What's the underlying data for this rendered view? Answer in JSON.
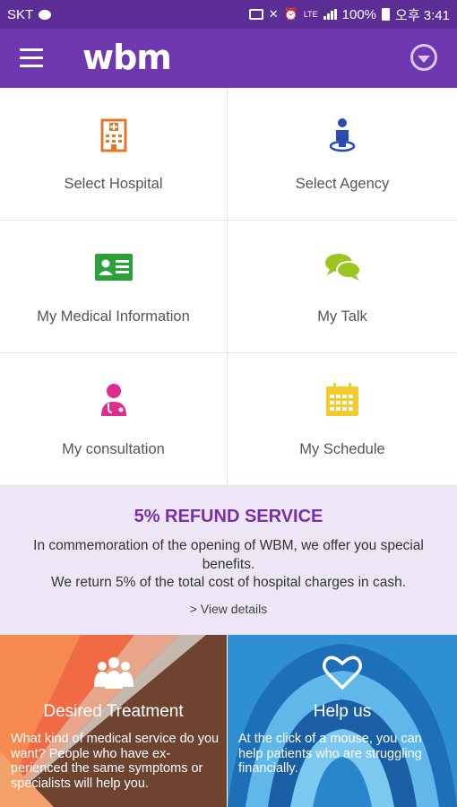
{
  "status_bar": {
    "carrier": "SKT",
    "battery": "100%",
    "time": "오후 3:41",
    "network": "LTE"
  },
  "app_bar": {
    "logo": "wbm",
    "icons": {
      "menu": "hamburger-menu-icon",
      "dropdown": "chevron-circle-down-icon"
    }
  },
  "menu_grid": [
    {
      "label": "Select Hospital",
      "icon": "hospital-building-icon",
      "color": "#e0782c"
    },
    {
      "label": "Select Agency",
      "icon": "person-location-icon",
      "color": "#2b4bb4"
    },
    {
      "label": "My Medical Information",
      "icon": "id-card-icon",
      "color": "#2ca03a"
    },
    {
      "label": "My Talk",
      "icon": "chat-bubbles-icon",
      "color": "#9bc51f"
    },
    {
      "label": "My consultation",
      "icon": "doctor-icon",
      "color": "#e02a8c"
    },
    {
      "label": "My Schedule",
      "icon": "calendar-icon",
      "color": "#f1cc2a"
    }
  ],
  "promo": {
    "title": "5% REFUND SERVICE",
    "line1": "In commemoration of the opening of WBM, we offer you special benefits.",
    "line2": "We return 5% of the total cost of hospital charges in cash.",
    "link": "> View details"
  },
  "panels": [
    {
      "title": "Desired Treatment",
      "text": "What kind of medical service do you want? People who have ex-perienced the same symptoms or specialists will help you.",
      "icon": "people-group-icon"
    },
    {
      "title": "Help us",
      "text": "At the click of a mouse, you can help patients who are struggling financially.",
      "icon": "heart-outline-icon"
    }
  ],
  "colors": {
    "status_bar": "#5b2d95",
    "app_bar": "#6f38b1",
    "promo_bg": "#ece6f6",
    "promo_title": "#7a2fa8"
  }
}
